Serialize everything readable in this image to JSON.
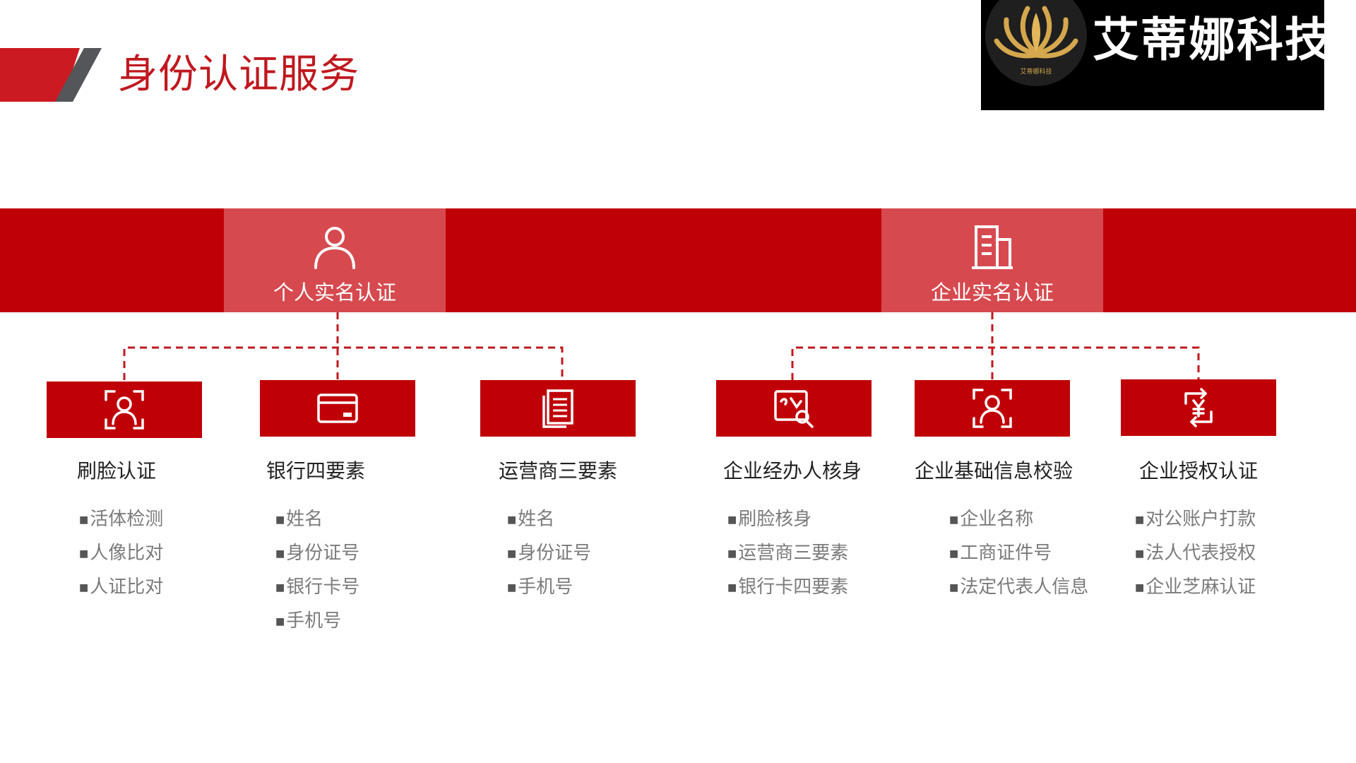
{
  "header": {
    "title": "身份认证服务"
  },
  "logo": {
    "brand": "艾蒂娜科技",
    "small_text": "艾蒂娜科技"
  },
  "colors": {
    "primary_red": "#c00007",
    "tile_red": "#d64a4f",
    "title_red": "#c0181f",
    "accent_gray": "#55565a"
  },
  "categories": [
    {
      "label": "个人实名认证",
      "icon": "person-icon"
    },
    {
      "label": "企业实名认证",
      "icon": "building-icon"
    }
  ],
  "services": [
    {
      "title": "刷脸认证",
      "icon": "face-scan-icon",
      "items": [
        "活体检测",
        "人像比对",
        "人证比对"
      ]
    },
    {
      "title": "银行四要素",
      "icon": "bank-card-icon",
      "items": [
        "姓名",
        "身份证号",
        "银行卡号",
        "手机号"
      ]
    },
    {
      "title": "运营商三要素",
      "icon": "document-icon",
      "items": [
        "姓名",
        "身份证号",
        "手机号"
      ]
    },
    {
      "title": "企业经办人核身",
      "icon": "id-card-search-icon",
      "items": [
        "刷脸核身",
        "运营商三要素",
        "银行卡四要素"
      ]
    },
    {
      "title": "企业基础信息校验",
      "icon": "face-scan-icon",
      "items": [
        "企业名称",
        "工商证件号",
        "法定代表人信息"
      ]
    },
    {
      "title": "企业授权认证",
      "icon": "yuan-transfer-icon",
      "items": [
        "对公账户打款",
        "法人代表授权",
        "企业芝麻认证"
      ]
    }
  ]
}
